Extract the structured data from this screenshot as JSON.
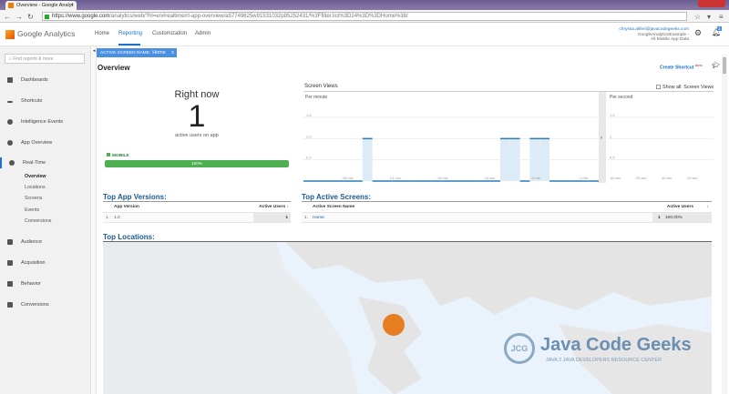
{
  "browser": {
    "tab_title": "Overview - Google Analyt",
    "url_host": "https://www.google.com",
    "url_path": "/analytics/web/?hl=en#realtime/rt-app-overview/a57749625w91531032p95252431/%3Ffilter.list%3D24%3D%3DHome%38/"
  },
  "header": {
    "logo": "Google Analytics",
    "nav": [
      "Home",
      "Reporting",
      "Customization",
      "Admin"
    ],
    "active_nav": "Reporting",
    "account_email": "chryssa.aliferi@javacodegeeks.com",
    "account_name": "GoogleAnalyticsExample -",
    "account_view": "All Mobile App Data",
    "notification_count": "1"
  },
  "sidebar": {
    "search_placeholder": "Find reports & more",
    "items": [
      "Dashboards",
      "Shortcuts",
      "Intelligence Events",
      "App Overview",
      "Real-Time",
      "Audience",
      "Acquisition",
      "Behavior",
      "Conversions"
    ],
    "realtime_sub": [
      "Overview",
      "Locations",
      "Screens",
      "Events",
      "Conversions"
    ]
  },
  "filter": {
    "label": "ACTIVE SCREEN NAME:",
    "value": "Home",
    "close": "X"
  },
  "page": {
    "title": "Overview",
    "create_shortcut": "Create Shortcut",
    "beta": "BETA"
  },
  "rightnow": {
    "heading": "Right now",
    "count": "1",
    "subtitle": "active users on app",
    "segment": "MOBILE",
    "segment_pct": "100%",
    "segment_value": 100
  },
  "screen_views": {
    "title": "Screen Views",
    "show_all": "Show all: Screen Views"
  },
  "chart_data": [
    {
      "type": "bar",
      "title": "Per minute",
      "ylim": [
        0,
        1.5
      ],
      "yticks": [
        "1.5",
        "1.0",
        "0.5"
      ],
      "xticks": [
        "-26 min",
        "-21 min",
        "-16 min",
        "-11 min",
        "-6 min",
        "-1 min"
      ],
      "values": [
        0,
        0,
        0,
        0,
        0,
        0,
        1,
        0,
        0,
        0,
        0,
        0,
        0,
        0,
        0,
        0,
        0,
        0,
        0,
        0,
        1,
        1,
        0,
        1,
        1,
        0,
        0,
        0,
        0,
        0
      ]
    },
    {
      "type": "bar",
      "title": "Per second",
      "ylim": [
        0,
        1.5
      ],
      "yticks": [
        "1.5",
        "1",
        "0.5"
      ],
      "xticks": [
        "-60 sec",
        "-45 sec",
        "-30 sec",
        "-15 sec"
      ],
      "values": []
    }
  ],
  "app_versions": {
    "title": "Top App Versions:",
    "col1": "App Version",
    "col2": "Active Users",
    "rows": [
      {
        "idx": "1.",
        "name": "1.0",
        "users": "1"
      }
    ]
  },
  "active_screens": {
    "title": "Top Active Screens:",
    "col1": "Active Screen Name",
    "col2": "Active Users",
    "rows": [
      {
        "idx": "1.",
        "name": "Home",
        "users": "1",
        "pct": "100.00%"
      }
    ]
  },
  "locations": {
    "title": "Top Locations:"
  },
  "watermark": {
    "brand": "Java Code Geeks",
    "tagline": "JAVA 2 JAVA DEVELOPERS RESOURCE CENTER"
  },
  "colors": {
    "accent": "#1a73c8",
    "green": "#4caf50",
    "marker": "#e67e22"
  }
}
